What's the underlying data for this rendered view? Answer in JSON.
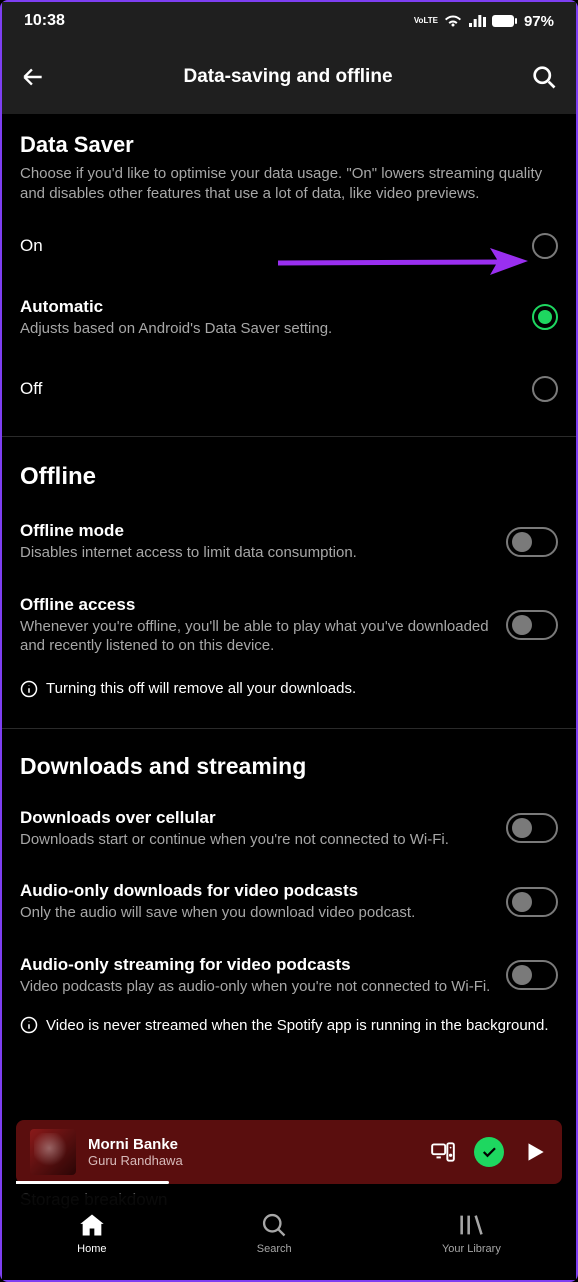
{
  "status": {
    "time": "10:38",
    "lte": "VoLTE",
    "battery": "97%"
  },
  "header": {
    "title": "Data-saving and offline"
  },
  "dataSaver": {
    "title": "Data Saver",
    "desc": "Choose if you'd like to optimise your data usage. \"On\" lowers streaming quality and disables other features that use a lot of data, like video previews.",
    "options": {
      "on": {
        "label": "On"
      },
      "auto": {
        "label": "Automatic",
        "sub": "Adjusts based on Android's Data Saver setting."
      },
      "off": {
        "label": "Off"
      }
    }
  },
  "offline": {
    "title": "Offline",
    "mode": {
      "label": "Offline mode",
      "sub": "Disables internet access to limit data consumption."
    },
    "access": {
      "label": "Offline access",
      "sub": "Whenever you're offline, you'll be able to play what you've downloaded and recently listened to on this device."
    },
    "warning": "Turning this off will remove all your downloads."
  },
  "downloads": {
    "title": "Downloads and streaming",
    "cellular": {
      "label": "Downloads over cellular",
      "sub": "Downloads start or continue when you're not connected to Wi-Fi."
    },
    "audioDl": {
      "label": "Audio-only downloads for video podcasts",
      "sub": "Only the audio will save when you download video podcast."
    },
    "audioStream": {
      "label": "Audio-only streaming for video podcasts",
      "sub": "Video podcasts play as audio-only when you're not connected to Wi-Fi."
    },
    "note": "Video is never streamed when the Spotify app is running in the background."
  },
  "player": {
    "title": "Morni Banke",
    "artist": "Guru Randhawa"
  },
  "nav": {
    "home": "Home",
    "search": "Search",
    "library": "Your Library"
  },
  "hidden": "Storage breakdown"
}
